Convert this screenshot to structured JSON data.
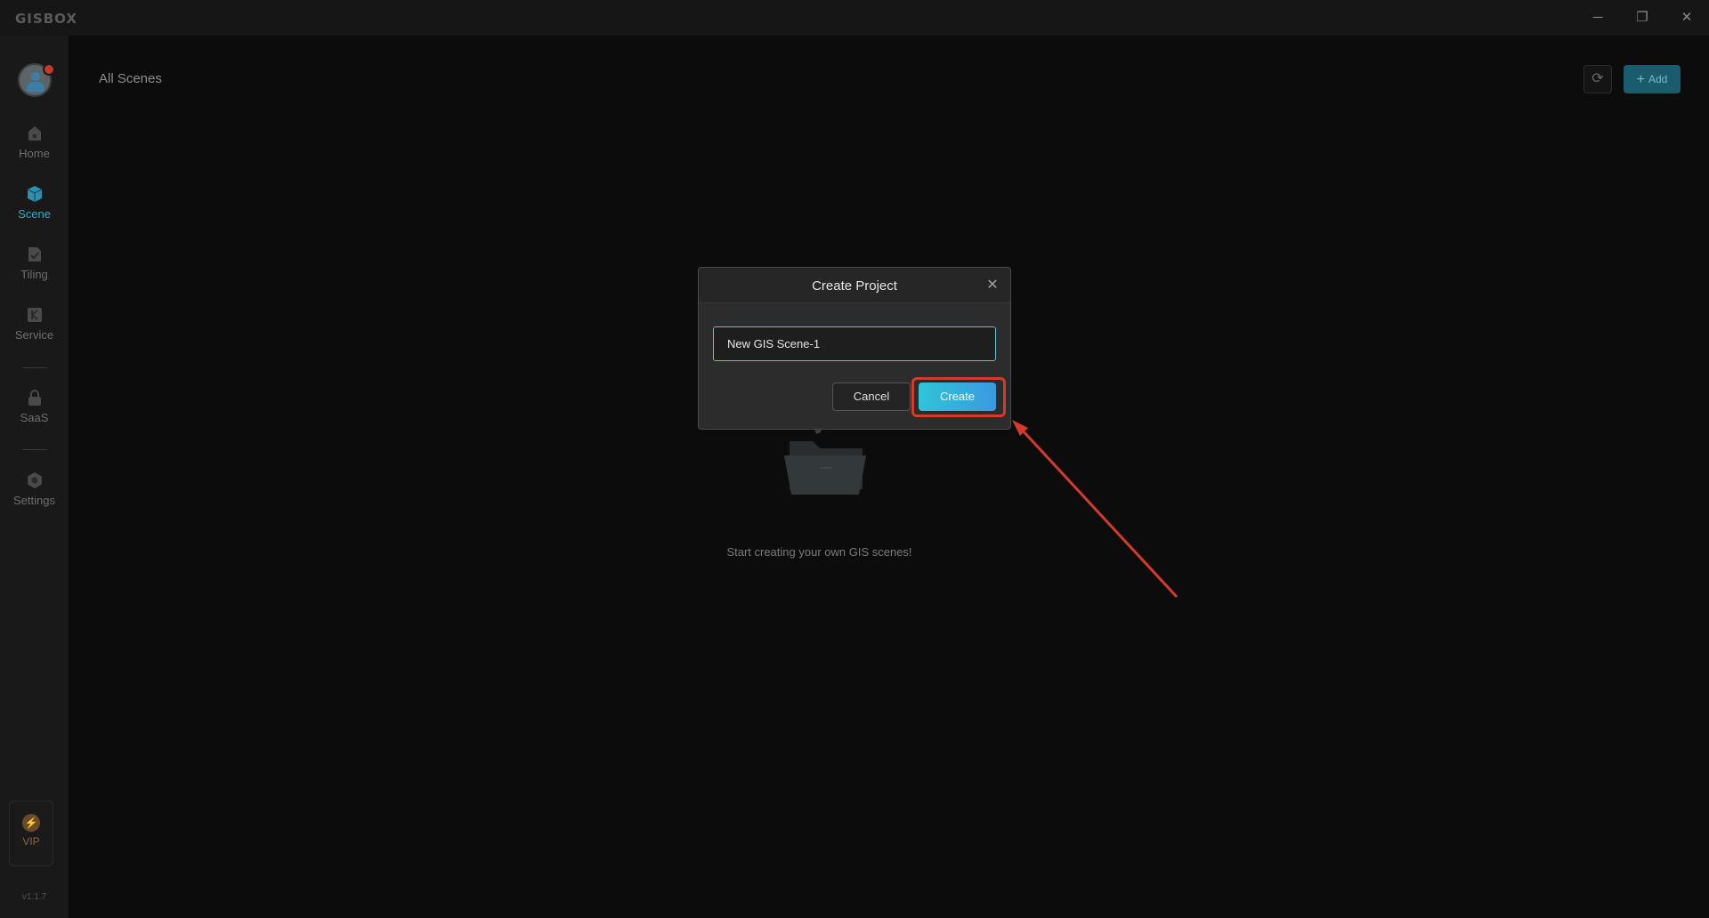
{
  "app": {
    "logo": "GISBOX"
  },
  "window_controls": {
    "minimize": "─",
    "restore": "❐",
    "close": "✕"
  },
  "sidebar": {
    "items": [
      {
        "label": "Home",
        "icon": "home-icon"
      },
      {
        "label": "Scene",
        "icon": "cube-icon",
        "active": true
      },
      {
        "label": "Tiling",
        "icon": "tiling-icon"
      },
      {
        "label": "Service",
        "icon": "service-icon"
      },
      {
        "label": "SaaS",
        "icon": "lock-icon"
      },
      {
        "label": "Settings",
        "icon": "gear-icon"
      }
    ],
    "vip": {
      "label": "VIP",
      "icon": "lightning-icon",
      "glyph": "⚡"
    },
    "version": "v1.1.7"
  },
  "main": {
    "title": "All Scenes",
    "refresh_icon": "⟳",
    "add_label": "Add",
    "add_plus": "+",
    "empty_text": "Start creating your own GIS scenes!"
  },
  "modal": {
    "title": "Create Project",
    "close_icon": "✕",
    "input_value": "New GIS Scene-1",
    "cancel_label": "Cancel",
    "create_label": "Create"
  },
  "annotation": {
    "color": "#d63a2a"
  },
  "colors": {
    "accent": "#3aa6c4",
    "primary_button": "#2fc4d8",
    "background": "#0c0c0c"
  }
}
